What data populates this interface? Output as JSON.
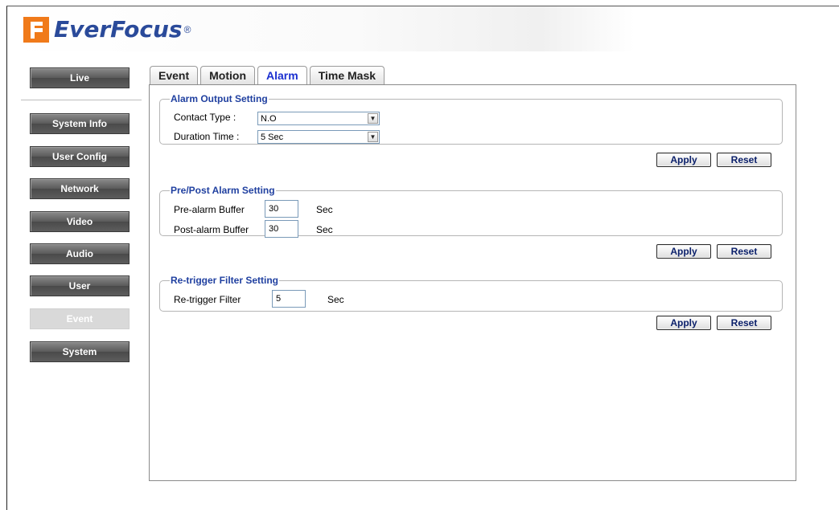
{
  "brand": {
    "name": "EverFocus",
    "reg": "®"
  },
  "sidebar": {
    "items": [
      {
        "label": "Live"
      },
      {
        "label": "System Info"
      },
      {
        "label": "User Config"
      },
      {
        "label": "Network"
      },
      {
        "label": "Video"
      },
      {
        "label": "Audio"
      },
      {
        "label": "User"
      },
      {
        "label": "Event",
        "active": true
      },
      {
        "label": "System"
      }
    ]
  },
  "tabs": [
    {
      "label": "Event"
    },
    {
      "label": "Motion"
    },
    {
      "label": "Alarm",
      "active": true
    },
    {
      "label": "Time Mask"
    }
  ],
  "alarm_output": {
    "legend": "Alarm Output Setting",
    "contact_type_label": "Contact Type :",
    "contact_type_value": "N.O",
    "duration_label": "Duration Time :",
    "duration_value": "5 Sec"
  },
  "prepost": {
    "legend": "Pre/Post Alarm Setting",
    "pre_label": "Pre-alarm Buffer",
    "pre_value": "30",
    "post_label": "Post-alarm Buffer",
    "post_value": "30",
    "unit": "Sec"
  },
  "retrigger": {
    "legend": "Re-trigger Filter Setting",
    "label": "Re-trigger Filter",
    "value": "5",
    "unit": "Sec"
  },
  "buttons": {
    "apply": "Apply",
    "reset": "Reset"
  },
  "colors": {
    "accent": "#1a2fd0",
    "legend": "#2040a0",
    "logo": "#2a4a9a",
    "logo_mark": "#f07a1a"
  }
}
